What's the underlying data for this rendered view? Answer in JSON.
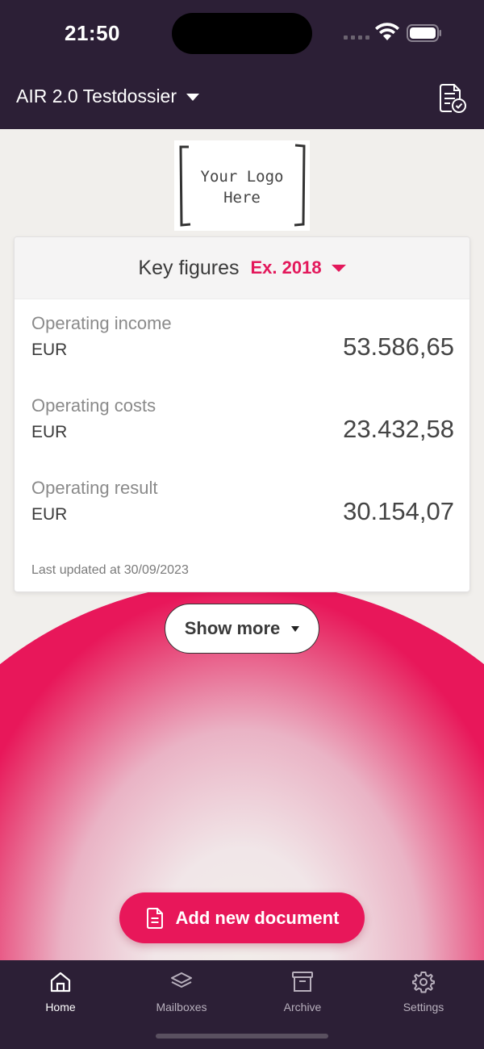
{
  "status_bar": {
    "time": "21:50"
  },
  "header": {
    "dossier_title": "AIR 2.0 Testdossier"
  },
  "logo": {
    "line1": "Your Logo",
    "line2": "Here"
  },
  "key_figures": {
    "title": "Key figures",
    "year": "Ex. 2018",
    "rows": [
      {
        "label": "Operating income",
        "unit": "EUR",
        "value": "53.586,65"
      },
      {
        "label": "Operating costs",
        "unit": "EUR",
        "value": "23.432,58"
      },
      {
        "label": "Operating result",
        "unit": "EUR",
        "value": "30.154,07"
      }
    ],
    "last_updated": "Last updated at 30/09/2023"
  },
  "show_more_label": "Show more",
  "add_document_label": "Add new document",
  "tabs": [
    {
      "label": "Home",
      "icon": "home-icon",
      "active": true
    },
    {
      "label": "Mailboxes",
      "icon": "layers-icon",
      "active": false
    },
    {
      "label": "Archive",
      "icon": "archive-icon",
      "active": false
    },
    {
      "label": "Settings",
      "icon": "gear-icon",
      "active": false
    }
  ],
  "colors": {
    "brand_dark": "#2c1f36",
    "accent": "#e8175a"
  }
}
